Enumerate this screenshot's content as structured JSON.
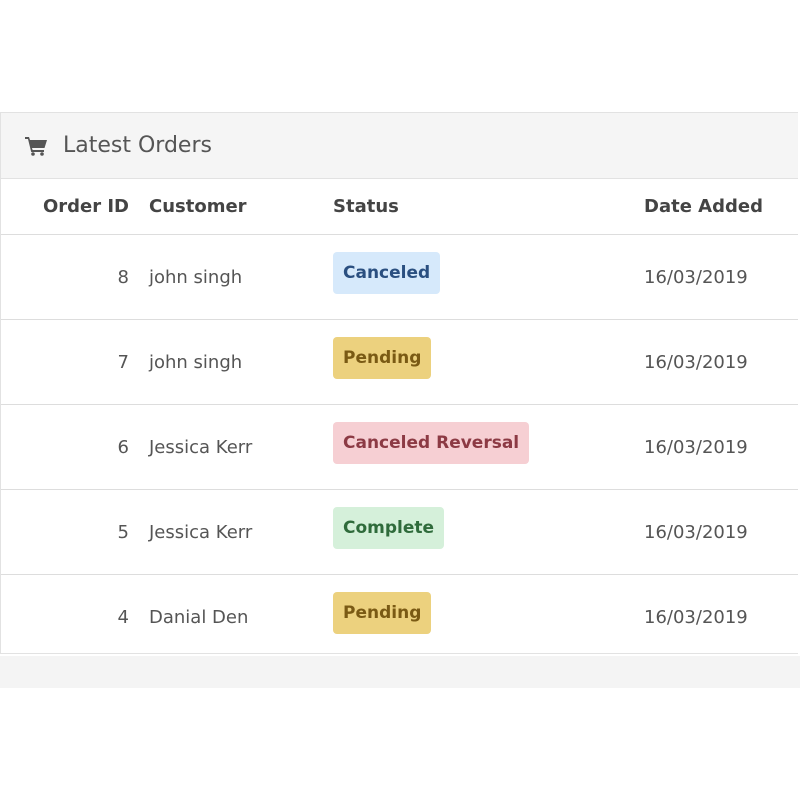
{
  "panel": {
    "title": "Latest Orders",
    "icon": "shopping-cart-icon"
  },
  "table": {
    "headers": {
      "order_id": "Order ID",
      "customer": "Customer",
      "status": "Status",
      "date_added": "Date Added"
    },
    "rows": [
      {
        "order_id": "8",
        "customer": "john singh",
        "status": "Canceled",
        "status_bg": "#d6e9fb",
        "status_fg": "#2a4f80",
        "date_added": "16/03/2019"
      },
      {
        "order_id": "7",
        "customer": "john singh",
        "status": "Pending",
        "status_bg": "#ecd17e",
        "status_fg": "#7a5a14",
        "date_added": "16/03/2019"
      },
      {
        "order_id": "6",
        "customer": "Jessica Kerr",
        "status": "Canceled Reversal",
        "status_bg": "#f6cfd3",
        "status_fg": "#8c3a44",
        "date_added": "16/03/2019"
      },
      {
        "order_id": "5",
        "customer": "Jessica Kerr",
        "status": "Complete",
        "status_bg": "#d5f0da",
        "status_fg": "#2f6b3b",
        "date_added": "16/03/2019"
      },
      {
        "order_id": "4",
        "customer": "Danial Den",
        "status": "Pending",
        "status_bg": "#ecd17e",
        "status_fg": "#7a5a14",
        "date_added": "16/03/2019"
      }
    ]
  },
  "colors": {
    "heading_bg": "#f5f5f5",
    "border": "#dddddd",
    "text": "#555555",
    "header_text": "#444444"
  }
}
